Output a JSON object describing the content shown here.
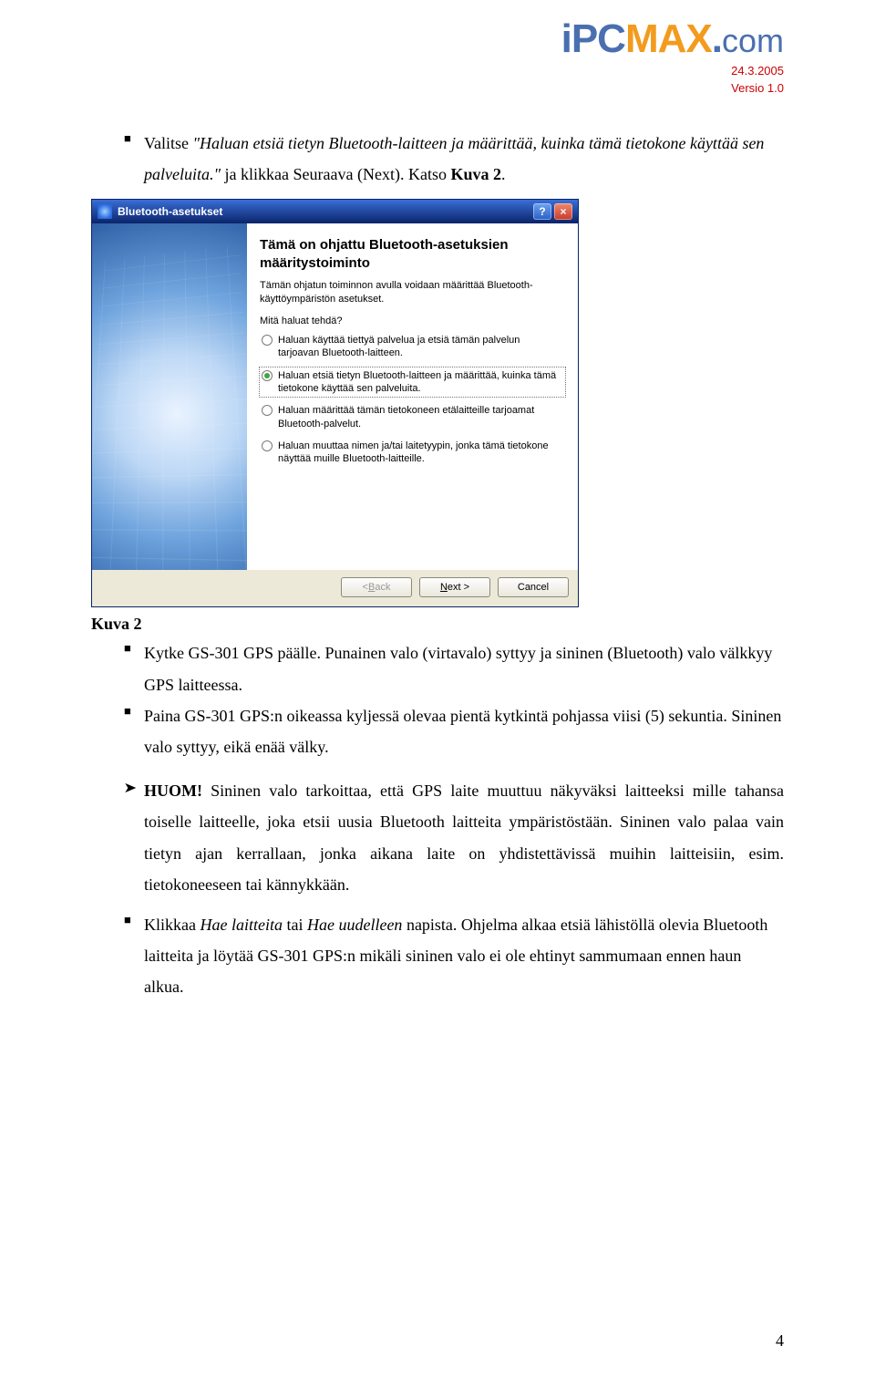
{
  "header": {
    "logo_ipc": "iPC",
    "logo_max": "MAX",
    "logo_dot": ".",
    "logo_com": "com",
    "date": "24.3.2005",
    "version": "Versio 1.0"
  },
  "intro": {
    "bullet1_pre": "Valitse ",
    "bullet1_quote": "\"Haluan etsiä tietyn Bluetooth-laitteen ja määrittää, kuinka tämä tietokone käyttää sen palveluita.\"",
    "bullet1_post": " ja klikkaa Seuraava (Next). Katso ",
    "bullet1_ref": "Kuva 2",
    "bullet1_end": "."
  },
  "dialog": {
    "title": "Bluetooth-asetukset",
    "help_glyph": "?",
    "close_glyph": "×",
    "heading": "Tämä on ohjattu Bluetooth-asetuksien määritystoiminto",
    "desc": "Tämän ohjatun toiminnon avulla voidaan määrittää Bluetooth-käyttöympäristön asetukset.",
    "question": "Mitä haluat tehdä?",
    "options": [
      "Haluan käyttää tiettyä palvelua ja etsiä tämän palvelun tarjoavan Bluetooth-laitteen.",
      "Haluan etsiä tietyn Bluetooth-laitteen ja määrittää, kuinka tämä tietokone käyttää sen palveluita.",
      "Haluan määrittää tämän tietokoneen etälaitteille tarjoamat Bluetooth-palvelut.",
      "Haluan muuttaa nimen ja/tai laitetyypin, jonka tämä tietokone näyttää muille Bluetooth-laitteille."
    ],
    "back_lt": "< ",
    "back_u": "B",
    "back_rest": "ack",
    "next_u": "N",
    "next_rest": "ext >",
    "cancel": "Cancel"
  },
  "caption": "Kuva 2",
  "after": {
    "b1": "Kytke GS-301 GPS päälle. Punainen valo (virtavalo) syttyy ja sininen (Bluetooth) valo välkkyy GPS laitteessa.",
    "b2": "Paina GS-301 GPS:n oikeassa kyljessä olevaa pientä kytkintä pohjassa viisi (5) sekuntia. Sininen valo syttyy, eikä enää välky.",
    "huom_label": "HUOM!",
    "huom_text": " Sininen valo tarkoittaa, että GPS laite muuttuu näkyväksi laitteeksi mille tahansa toiselle laitteelle, joka etsii uusia Bluetooth laitteita ympäristöstään. Sininen valo palaa vain tietyn ajan kerrallaan, jonka aikana laite on yhdistettävissä muihin laitteisiin, esim. tietokoneeseen tai kännykkään.",
    "b3_pre": "Klikkaa ",
    "b3_i1": "Hae laitteita",
    "b3_mid": " tai ",
    "b3_i2": "Hae uudelleen",
    "b3_post": " napista. Ohjelma alkaa etsiä lähistöllä olevia Bluetooth laitteita ja löytää GS-301 GPS:n mikäli sininen valo ei ole ehtinyt sammumaan ennen haun alkua."
  },
  "page_number": "4"
}
